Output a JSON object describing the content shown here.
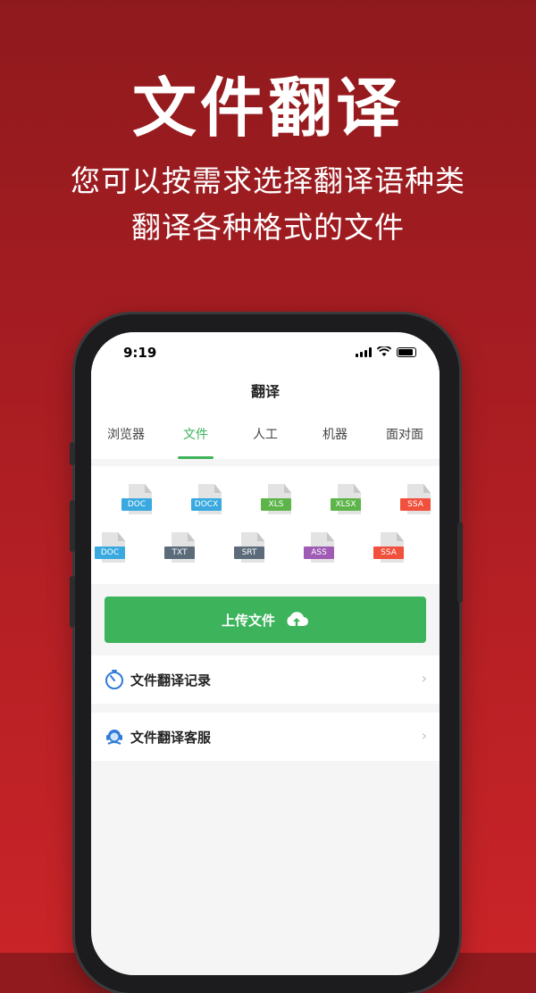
{
  "hero": {
    "title": "文件翻译",
    "subtitle_line1": "您可以按需求选择翻译语种类",
    "subtitle_line2": "翻译各种格式的文件"
  },
  "status_bar": {
    "time": "9:19"
  },
  "app": {
    "title": "翻译",
    "tabs": [
      {
        "label": "浏览器",
        "active": false
      },
      {
        "label": "文件",
        "active": true
      },
      {
        "label": "人工",
        "active": false
      },
      {
        "label": "机器",
        "active": false
      },
      {
        "label": "面对面",
        "active": false
      }
    ],
    "file_types": [
      {
        "label": "DOC",
        "color": "#39a9e0"
      },
      {
        "label": "DOCX",
        "color": "#39a9e0"
      },
      {
        "label": "XLS",
        "color": "#5db54a"
      },
      {
        "label": "XLSX",
        "color": "#5db54a"
      },
      {
        "label": "SSA",
        "color": "#f0503c"
      },
      {
        "label": "DOC",
        "color": "#39a9e0"
      },
      {
        "label": "TXT",
        "color": "#5b6b7a"
      },
      {
        "label": "SRT",
        "color": "#5b6b7a"
      },
      {
        "label": "ASS",
        "color": "#a05bb5"
      },
      {
        "label": "SSA",
        "color": "#f0503c"
      }
    ],
    "upload_button": {
      "label": "上传文件",
      "icon": "cloud-upload-icon"
    },
    "menu": [
      {
        "label": "文件翻译记录",
        "icon": "timer-icon"
      },
      {
        "label": "文件翻译客服",
        "icon": "customer-service-icon"
      }
    ]
  },
  "colors": {
    "accent": "#3db35c",
    "background": "#b01f24"
  }
}
